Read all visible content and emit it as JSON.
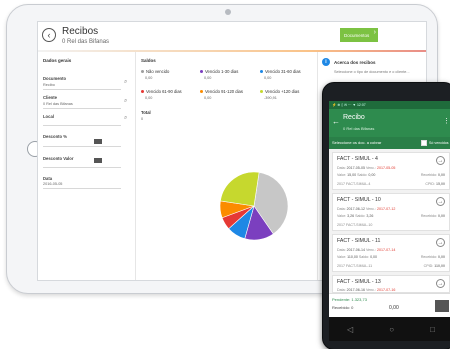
{
  "tablet": {
    "title": "Recibos",
    "subtitle": "0 Rel das Bifanas",
    "documentos_button": "Documentos",
    "left": {
      "section_title": "Dados gerais",
      "fields": [
        {
          "label": "Documento",
          "value": "Recibo"
        },
        {
          "label": "Cliente",
          "value": "0 Rel das Bifanas"
        },
        {
          "label": "Local",
          "value": ""
        },
        {
          "label": "Desconto %",
          "value": ""
        },
        {
          "label": "Desconto Valor",
          "value": ""
        },
        {
          "label": "Data",
          "value": "2016-05-05"
        }
      ]
    },
    "mid": {
      "section_title": "Saldos",
      "kpis": [
        {
          "label": "Não vencido",
          "value": "0,00",
          "color": "#9e9e9e"
        },
        {
          "label": "Vencido 1-30 dias",
          "value": "0,00",
          "color": "#7b3fbf"
        },
        {
          "label": "Vencido 31-60 dias",
          "value": "0,00",
          "color": "#1e88e5"
        },
        {
          "label": "Vencido 61-90 dias",
          "value": "0,00",
          "color": "#e53935"
        },
        {
          "label": "Vencido 91-120 dias",
          "value": "0,00",
          "color": "#fb8c00"
        },
        {
          "label": "Vencido +120 dias",
          "value": "-390,91",
          "color": "#c6d82e"
        }
      ],
      "total_label": "Total",
      "total_value": "0"
    },
    "right": {
      "info_title": "Acerca dos recibos",
      "info_text": "Seleccione o tipo de documento e o cliente..."
    }
  },
  "phone": {
    "status": "⚡ ⊕ ▯   ✉ ⋯ ▼ 12:07",
    "title": "Recibo",
    "subtitle": "0 Rel das Bifanas",
    "filter_label": "Seleccione os doc. a cobrar",
    "filter_check_label": "Só vencidos",
    "cards": [
      {
        "title": "FACT - SIMUL - 4",
        "data": "2017-05-05",
        "venc": "2017-05-05",
        "valor": "15,00",
        "saldo": "0,00",
        "recebido": "0,00",
        "doc": "2017 FACT-SIMUL-4",
        "cpid": "15,00"
      },
      {
        "title": "FACT - SIMUL - 10",
        "data": "2017-06-12",
        "venc": "2017-07-12",
        "valor": "3,26",
        "saldo": "3,26",
        "recebido": "0,00",
        "doc": "2017 FACT-SIMUL-10",
        "cpid": ""
      },
      {
        "title": "FACT - SIMUL - 11",
        "data": "2017-06-14",
        "venc": "2017-07-14",
        "valor": "110,00",
        "saldo": "0,00",
        "recebido": "0,00",
        "doc": "2017 FACT-SIMUL-11",
        "cpid": "110,00"
      },
      {
        "title": "FACT - SIMUL - 13",
        "data": "2017-06-16",
        "venc": "2017-07-16",
        "valor": "23,67",
        "saldo": "23,67",
        "recebido": "0,00",
        "doc": "",
        "cpid": ""
      }
    ],
    "labels": {
      "data": "Data:",
      "venc": "Venc.:",
      "valor": "Valor:",
      "saldo": "Saldo:",
      "recebido": "Recebido:",
      "cpid": "CPID:"
    },
    "bottom": {
      "pendente_label": "Pendente:",
      "pendente_value": "1.323,73",
      "recebido_label": "Recebido:",
      "recebido_value": "0",
      "total_value": "0,00"
    }
  },
  "chart_data": {
    "type": "pie",
    "slices": [
      {
        "name": "Não vencido",
        "value": 38,
        "color": "#c7c7c7"
      },
      {
        "name": "Vencido 1-30 dias",
        "value": 14,
        "color": "#7b3fbf"
      },
      {
        "name": "Vencido 31-60 dias",
        "value": 9,
        "color": "#1e88e5"
      },
      {
        "name": "Vencido 61-90 dias",
        "value": 6,
        "color": "#e53935"
      },
      {
        "name": "Vencido 91-120 dias",
        "value": 8,
        "color": "#fb8c00"
      },
      {
        "name": "Vencido +120 dias",
        "value": 25,
        "color": "#c6d82e"
      }
    ]
  }
}
